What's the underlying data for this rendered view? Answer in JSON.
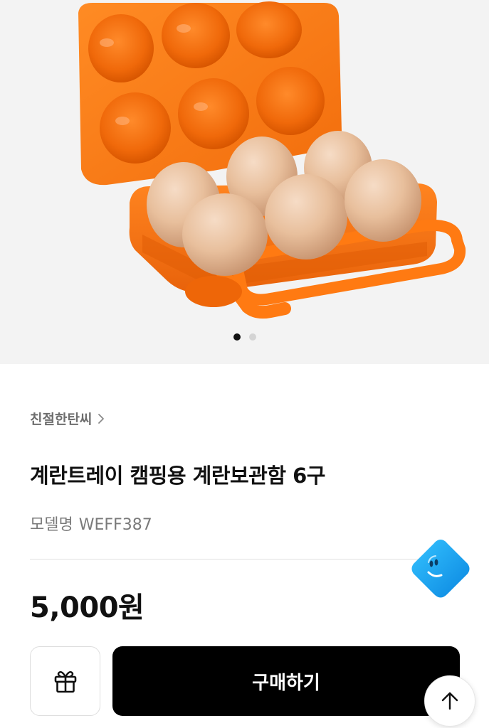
{
  "carousel": {
    "image_alt": "orange 6-egg camping tray with brown eggs",
    "current_slide": 1,
    "total_slides": 2
  },
  "product": {
    "brand": "친절한탄씨",
    "title": "계란트레이 캠핑용 계란보관함 6구",
    "model_label": "모델명",
    "model_value": "WEFF387",
    "price": "5,000원"
  },
  "actions": {
    "buy_label": "구매하기"
  },
  "icons": {
    "brand_chevron": "chevron-right-icon",
    "gift": "gift-icon",
    "scroll_top": "arrow-up-icon",
    "assistant": "assistant-badge-icon"
  },
  "colors": {
    "tray_orange": "#ff7a0f",
    "buy_button_bg": "#000000",
    "assistant_blue": "#1aa7ee",
    "hero_bg": "#f3f3f3"
  }
}
